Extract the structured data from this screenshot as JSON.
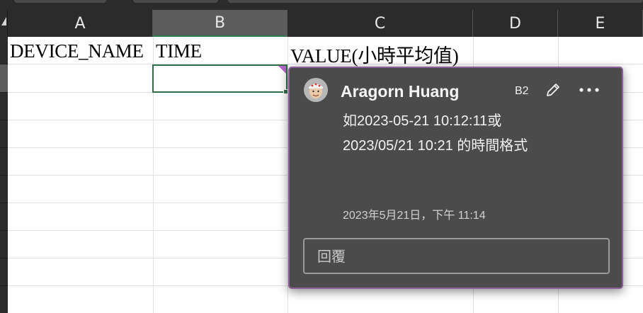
{
  "columns": [
    {
      "letter": "A"
    },
    {
      "letter": "B"
    },
    {
      "letter": "C"
    },
    {
      "letter": "D"
    },
    {
      "letter": "E"
    }
  ],
  "cells": {
    "A1": "DEVICE_NAME",
    "B1": "TIME",
    "C1": "VALUE(小時平均值)"
  },
  "selected_cell": "B2",
  "comment": {
    "author": "Aragorn Huang",
    "cell_ref": "B2",
    "body_line1": "如2023-05-21 10:12:11或",
    "body_line2": "2023/05/21 10:21 的時間格式",
    "timestamp": "2023年5月21日，下午 11:14",
    "reply_placeholder": "回覆",
    "icons": {
      "avatar": "user-avatar",
      "edit": "pencil-icon",
      "more": "ellipsis-icon"
    }
  },
  "colors": {
    "selection_border": "#2f6f46",
    "comment_marker": "#b565c7",
    "comment_card_bg": "#4b4b4b",
    "comment_card_border": "#8e5e9a",
    "header_bg": "#2b2b2b"
  }
}
